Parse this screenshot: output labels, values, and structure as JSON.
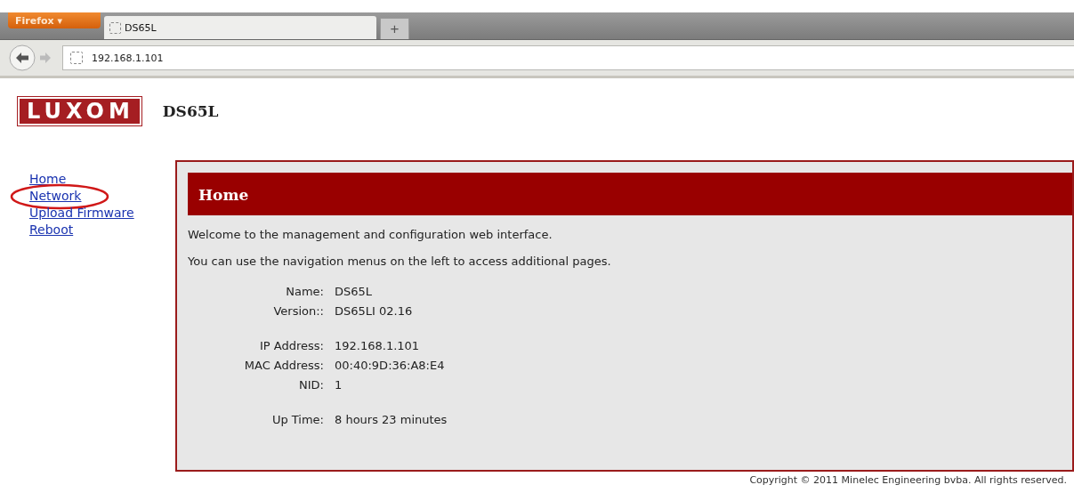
{
  "browser": {
    "menu_button": "Firefox ▾",
    "tabs": [
      {
        "title": "DS65L",
        "selected": true
      }
    ],
    "new_tab": "+",
    "address": "192.168.1.101"
  },
  "header": {
    "logo": "LUXOM",
    "device": "DS65L"
  },
  "sidebar": {
    "items": [
      {
        "label": "Home",
        "circled": false
      },
      {
        "label": "Network",
        "circled": true
      },
      {
        "label": "Upload Firmware",
        "circled": false
      },
      {
        "label": "Reboot",
        "circled": false
      }
    ]
  },
  "panel": {
    "title": "Home",
    "paragraphs": [
      "Welcome to the management and configuration web interface.",
      "You can use the navigation menus on the left to access additional pages."
    ],
    "groups": [
      [
        {
          "label": "Name:",
          "value": "DS65L"
        },
        {
          "label": "Version::",
          "value": "DS65LI 02.16"
        }
      ],
      [
        {
          "label": "IP Address:",
          "value": "192.168.1.101"
        },
        {
          "label": "MAC Address:",
          "value": "00:40:9D:36:A8:E4"
        },
        {
          "label": "NID:",
          "value": "1"
        }
      ],
      [
        {
          "label": "Up Time:",
          "value": "8 hours 23 minutes"
        }
      ]
    ]
  },
  "footer": "Copyright © 2011 Minelec Engineering bvba. All rights reserved."
}
